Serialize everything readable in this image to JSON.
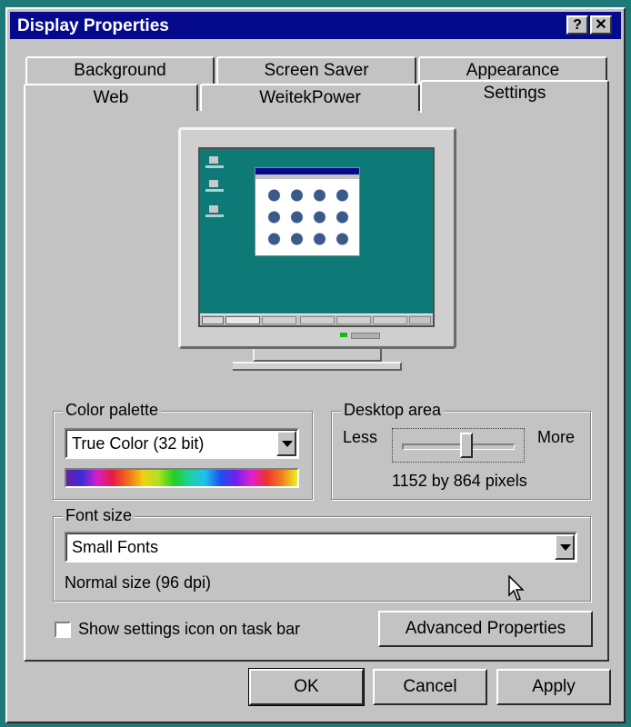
{
  "window": {
    "title": "Display Properties",
    "help_button": "?",
    "close_button": "✕"
  },
  "tabs": {
    "row1": [
      "Background",
      "Screen Saver",
      "Appearance"
    ],
    "row2": [
      "Web",
      "WeitekPower",
      "Settings"
    ],
    "active": "Settings"
  },
  "color_palette": {
    "label": "Color palette",
    "selected": "True Color (32 bit)"
  },
  "desktop_area": {
    "label": "Desktop area",
    "less_label": "Less",
    "more_label": "More",
    "resolution_text": "1152 by 864 pixels",
    "slider_level": 0.58
  },
  "font_size": {
    "label": "Font size",
    "selected": "Small Fonts",
    "description": "Normal size (96 dpi)"
  },
  "taskbar_checkbox": {
    "label": "Show settings icon on task bar",
    "checked": false
  },
  "buttons": {
    "advanced": "Advanced Properties",
    "ok": "OK",
    "cancel": "Cancel",
    "apply": "Apply"
  },
  "colors": {
    "title_bar": "#050a8c",
    "face": "#c3c3c3",
    "desktop_teal": "#0e7a78"
  }
}
